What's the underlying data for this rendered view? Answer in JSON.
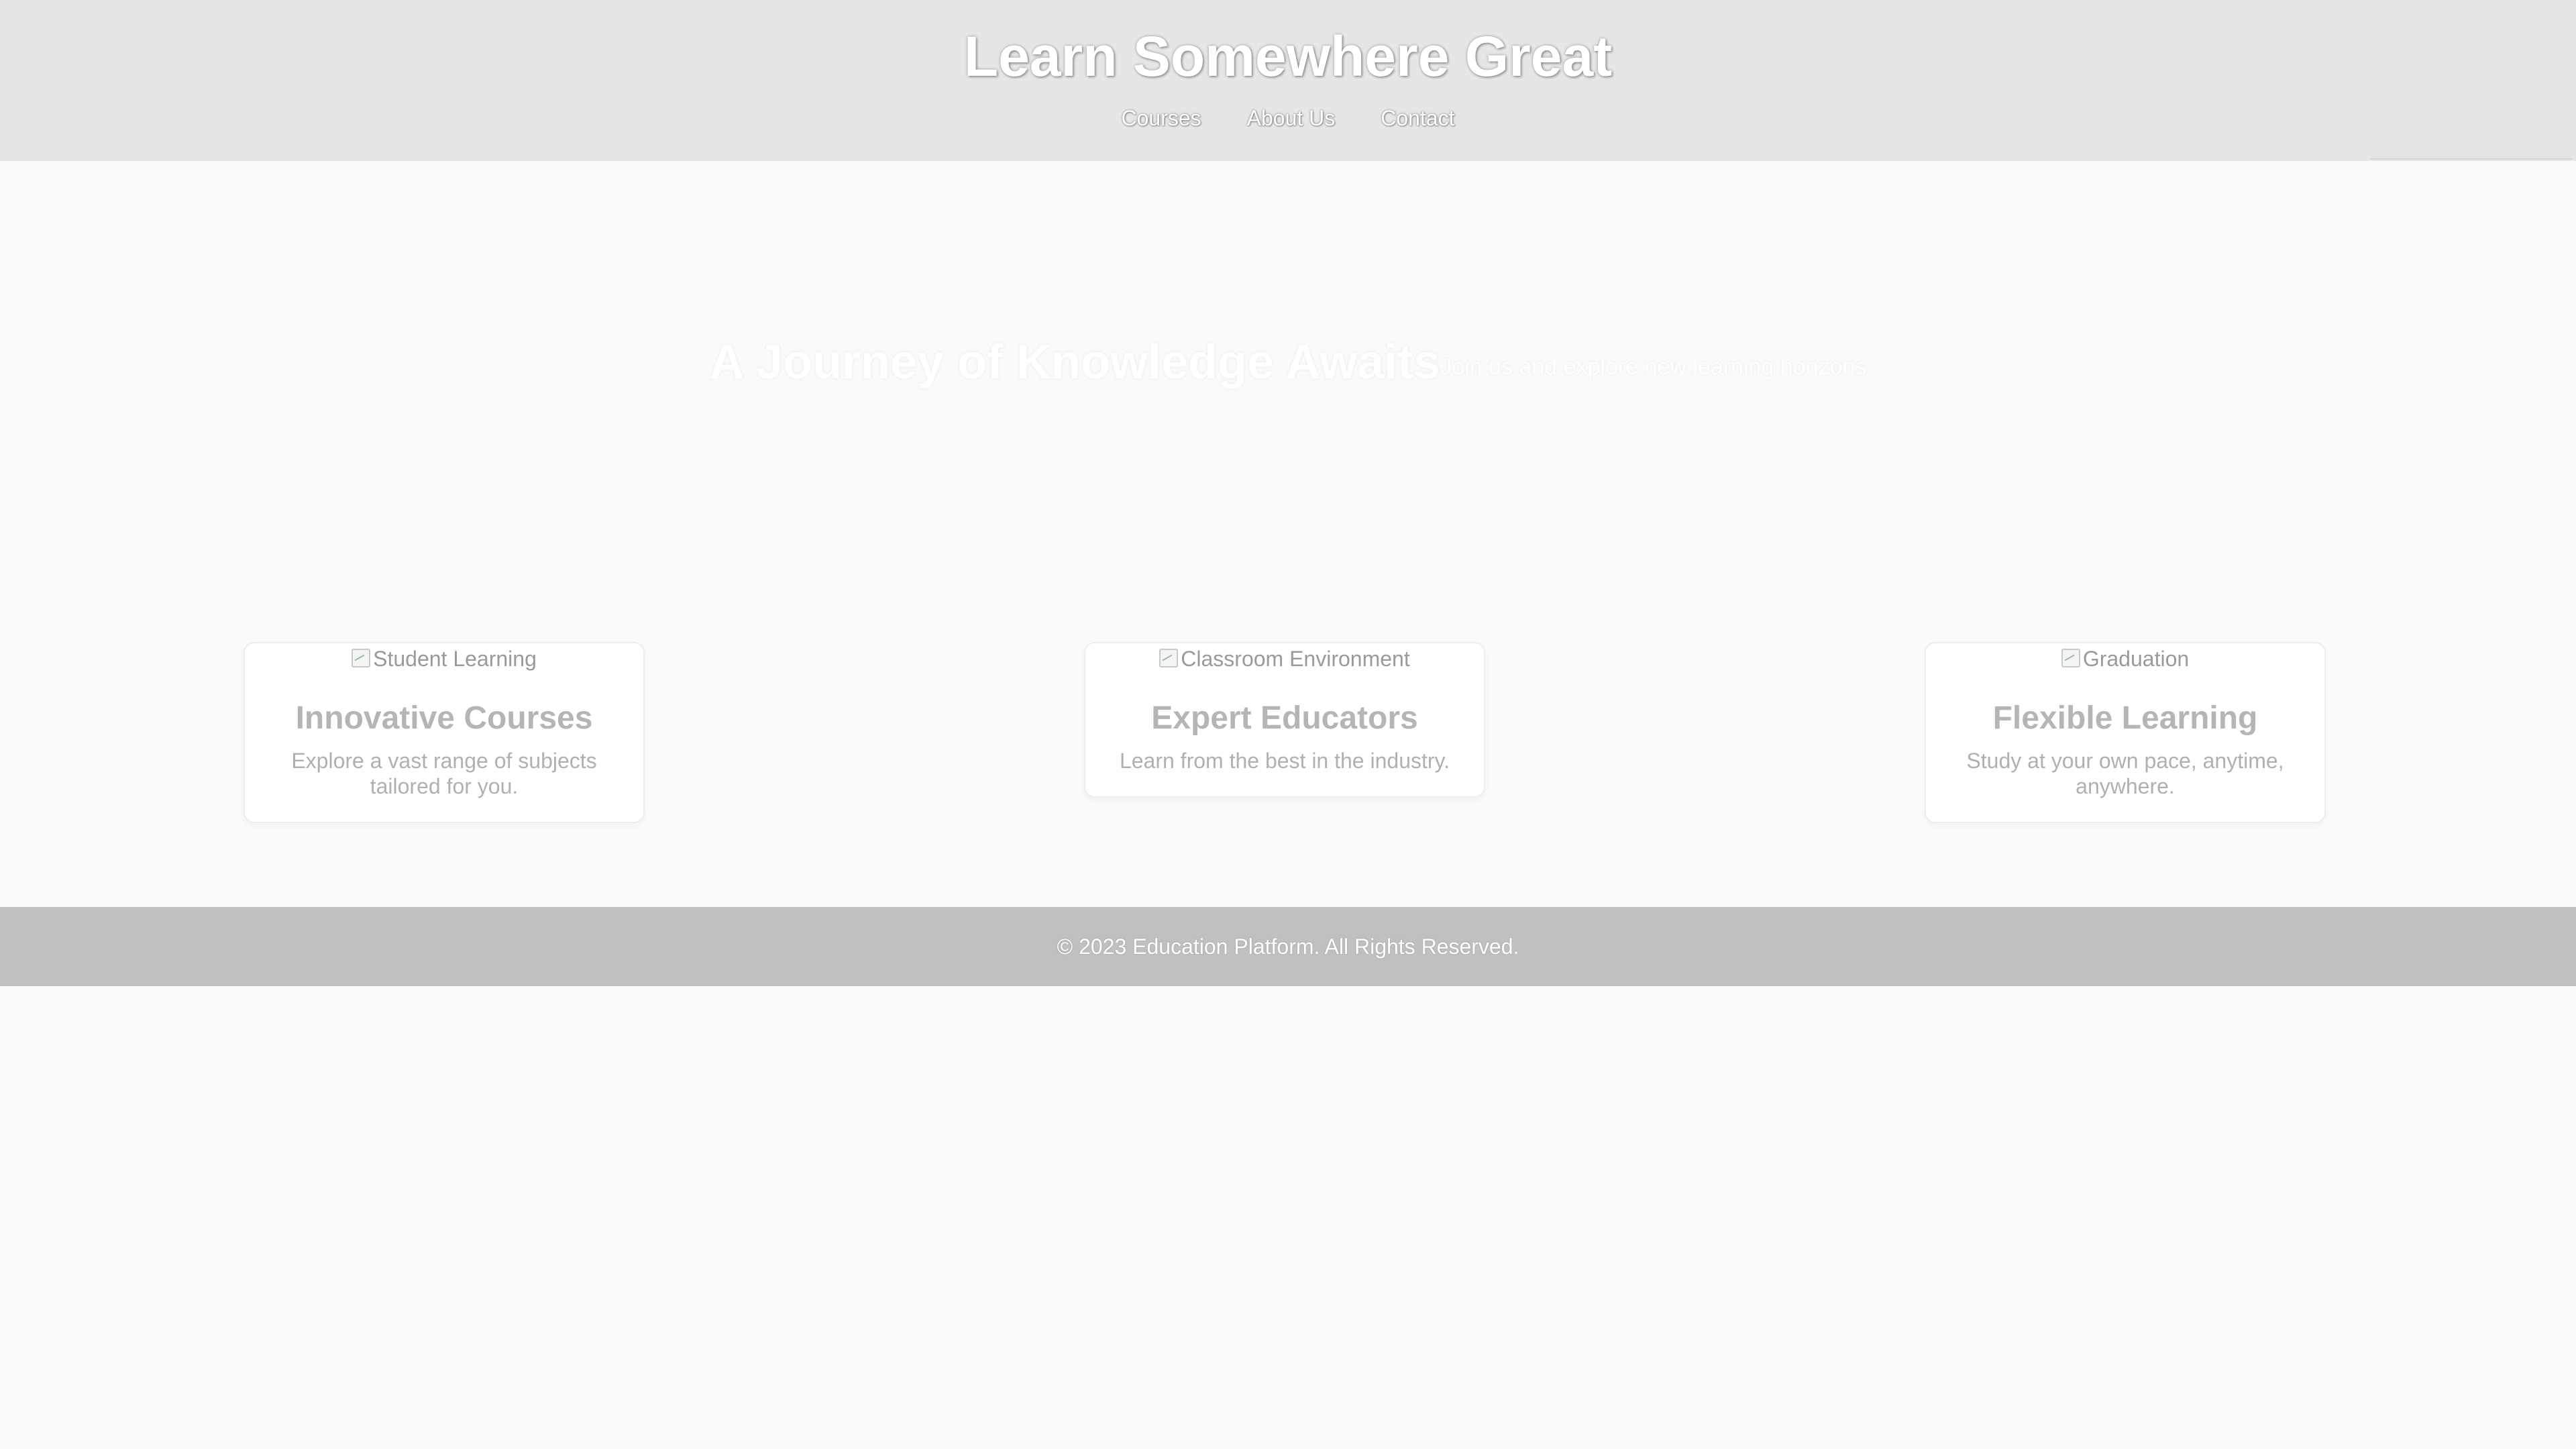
{
  "header": {
    "title": "Learn Somewhere Great",
    "nav": [
      {
        "label": "Courses"
      },
      {
        "label": "About Us"
      },
      {
        "label": "Contact"
      }
    ]
  },
  "hero": {
    "title": "A Journey of Knowledge Awaits",
    "subtitle": "Join us and explore new learning horizons"
  },
  "cards": [
    {
      "image_alt": "Student Learning",
      "title": "Innovative Courses",
      "description": "Explore a vast range of subjects tailored for you."
    },
    {
      "image_alt": "Classroom Environment",
      "title": "Expert Educators",
      "description": "Learn from the best in the industry."
    },
    {
      "image_alt": "Graduation",
      "title": "Flexible Learning",
      "description": "Study at your own pace, anytime, anywhere."
    }
  ],
  "footer": {
    "text": "© 2023 Education Platform. All Rights Reserved."
  },
  "colors": {
    "header_bg": "#e6e6e6",
    "page_bg": "#fafafa",
    "footer_bg": "#c0c0c0",
    "card_title": "#b5b5b5"
  }
}
